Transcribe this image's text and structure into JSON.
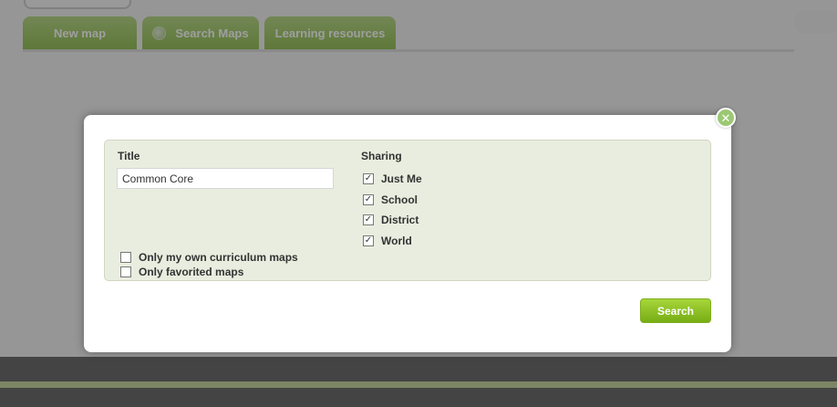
{
  "tabs": [
    {
      "label": "New map"
    },
    {
      "label": "Search Maps",
      "icon": "globe-icon"
    },
    {
      "label": "Learning resources"
    }
  ],
  "colors": {
    "accent_green": "#9cc873",
    "search_button": "#8cc42a",
    "panel_bg": "#e9eddf"
  },
  "search_dialog": {
    "close_icon": "close-icon",
    "title_label": "Title",
    "title_value": "Common Core",
    "sharing_label": "Sharing",
    "sharing_options": [
      {
        "label": "Just Me",
        "checked": true
      },
      {
        "label": "School",
        "checked": true
      },
      {
        "label": "District",
        "checked": true
      },
      {
        "label": "World",
        "checked": true
      }
    ],
    "filters": [
      {
        "label": "Only my own curriculum maps",
        "checked": false
      },
      {
        "label": "Only favorited maps",
        "checked": false
      }
    ],
    "search_button": "Search"
  }
}
